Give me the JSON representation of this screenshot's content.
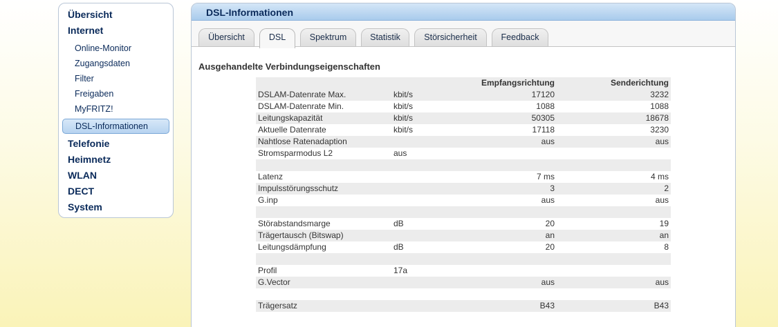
{
  "sidebar": {
    "items": [
      {
        "label": "Übersicht"
      },
      {
        "label": "Internet"
      },
      {
        "label": "Telefonie"
      },
      {
        "label": "Heimnetz"
      },
      {
        "label": "WLAN"
      },
      {
        "label": "DECT"
      },
      {
        "label": "System"
      }
    ],
    "internet_sub": [
      {
        "label": "Online-Monitor"
      },
      {
        "label": "Zugangsdaten"
      },
      {
        "label": "Filter"
      },
      {
        "label": "Freigaben"
      },
      {
        "label": "MyFRITZ!"
      },
      {
        "label": "DSL-Informationen"
      }
    ]
  },
  "panel": {
    "title": "DSL-Informationen",
    "tabs": [
      {
        "label": "Übersicht"
      },
      {
        "label": "DSL"
      },
      {
        "label": "Spektrum"
      },
      {
        "label": "Statistik"
      },
      {
        "label": "Störsicherheit"
      },
      {
        "label": "Feedback"
      }
    ],
    "section_title": "Ausgehandelte Verbindungseigenschaften"
  },
  "table": {
    "headers": [
      "",
      "",
      "Empfangsrichtung",
      "Senderichtung"
    ],
    "rows": [
      [
        "DSLAM-Datenrate Max.",
        "kbit/s",
        "17120",
        "3232"
      ],
      [
        "DSLAM-Datenrate Min.",
        "kbit/s",
        "1088",
        "1088"
      ],
      [
        "Leitungskapazität",
        "kbit/s",
        "50305",
        "18678"
      ],
      [
        "Aktuelle Datenrate",
        "kbit/s",
        "17118",
        "3230"
      ],
      [
        "Nahtlose Ratenadaption",
        "",
        "aus",
        "aus"
      ],
      [
        "Stromsparmodus L2",
        "aus",
        "",
        ""
      ],
      [
        "",
        "",
        "",
        ""
      ],
      [
        "Latenz",
        "",
        "7 ms",
        "4 ms"
      ],
      [
        "Impulsstörungsschutz",
        "",
        "3",
        "2"
      ],
      [
        "G.inp",
        "",
        "aus",
        "aus"
      ],
      [
        "",
        "",
        "",
        ""
      ],
      [
        "Störabstandsmarge",
        "dB",
        "20",
        "19"
      ],
      [
        "Trägertausch (Bitswap)",
        "",
        "an",
        "an"
      ],
      [
        "Leitungsdämpfung",
        "dB",
        "20",
        "8"
      ],
      [
        "",
        "",
        "",
        ""
      ],
      [
        "Profil",
        "17a",
        "",
        ""
      ],
      [
        "G.Vector",
        "",
        "aus",
        "aus"
      ],
      [
        "",
        "",
        "",
        ""
      ],
      [
        "Trägersatz",
        "",
        "B43",
        "B43"
      ]
    ]
  }
}
